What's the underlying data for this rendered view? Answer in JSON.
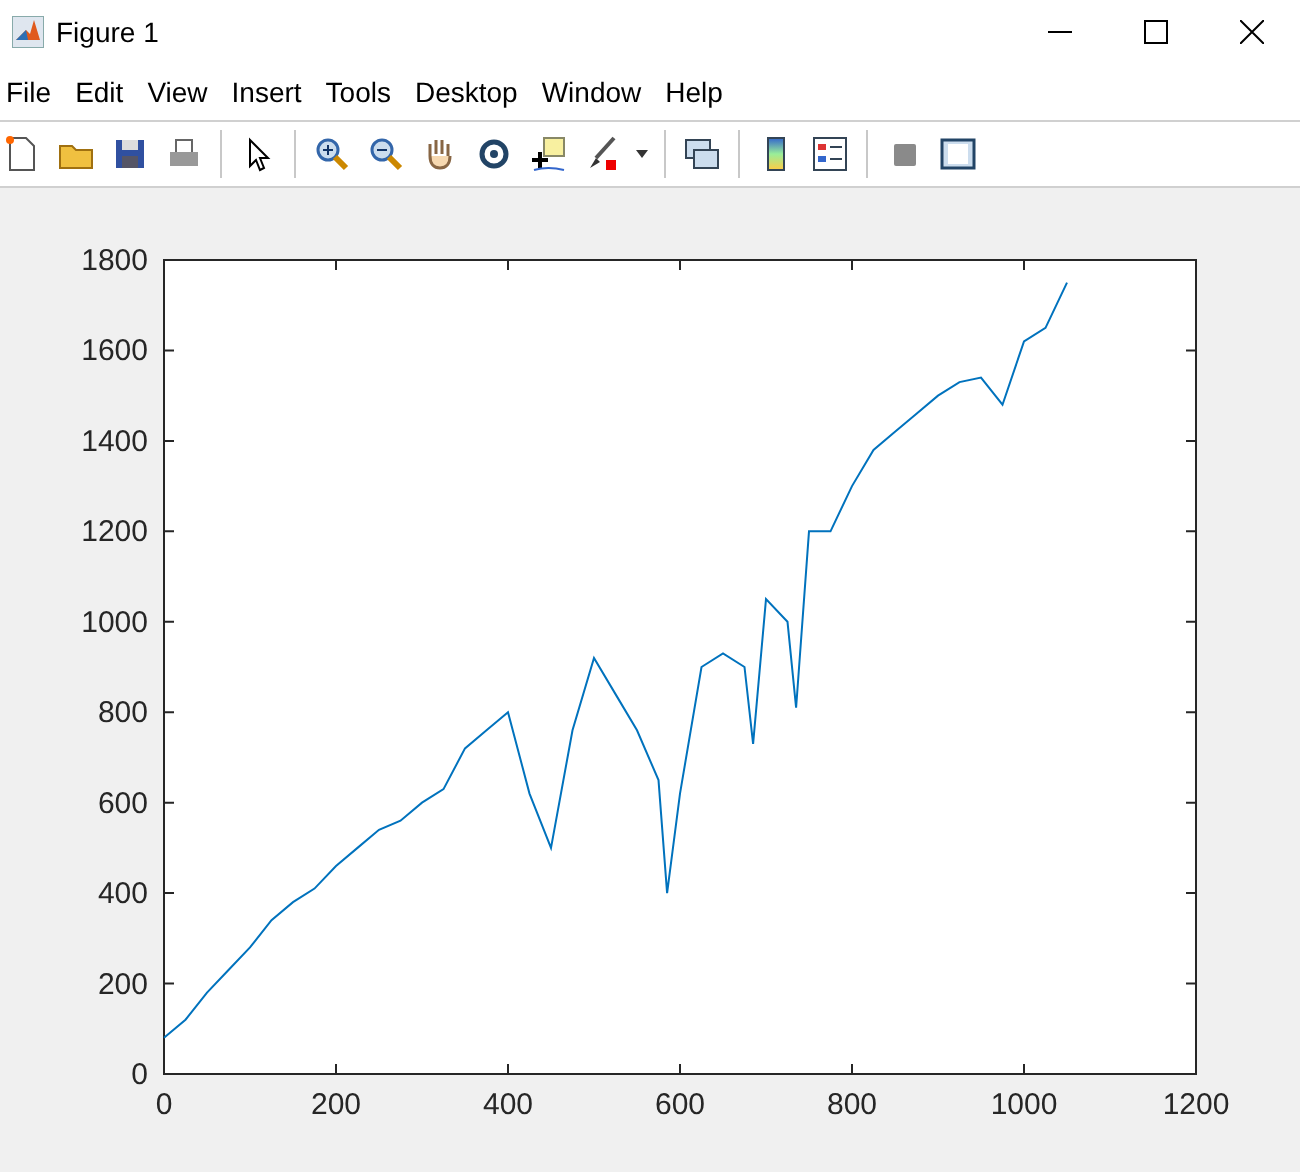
{
  "window": {
    "title": "Figure 1"
  },
  "menu": [
    "File",
    "Edit",
    "View",
    "Insert",
    "Tools",
    "Desktop",
    "Window",
    "Help"
  ],
  "figure": {
    "chart_data": {
      "type": "line",
      "x": [
        0,
        25,
        50,
        75,
        100,
        125,
        150,
        175,
        200,
        225,
        250,
        275,
        300,
        325,
        350,
        375,
        400,
        425,
        450,
        475,
        500,
        525,
        550,
        575,
        585,
        600,
        625,
        650,
        675,
        685,
        700,
        725,
        735,
        750,
        775,
        800,
        825,
        850,
        875,
        900,
        925,
        950,
        975,
        1000,
        1025,
        1050
      ],
      "series": [
        {
          "color": "#0072bd",
          "values": [
            80,
            120,
            180,
            230,
            280,
            340,
            380,
            410,
            460,
            500,
            540,
            560,
            600,
            630,
            720,
            760,
            800,
            620,
            500,
            760,
            920,
            840,
            760,
            650,
            400,
            620,
            900,
            930,
            900,
            730,
            1050,
            1000,
            810,
            1200,
            1200,
            1300,
            1380,
            1420,
            1460,
            1500,
            1530,
            1540,
            1480,
            1620,
            1650,
            1750
          ]
        }
      ],
      "xlim": [
        0,
        1200
      ],
      "ylim": [
        0,
        1800
      ],
      "xticks": [
        0,
        200,
        400,
        600,
        800,
        1000,
        1200
      ],
      "yticks": [
        0,
        200,
        400,
        600,
        800,
        1000,
        1200,
        1400,
        1600,
        1800
      ]
    }
  }
}
